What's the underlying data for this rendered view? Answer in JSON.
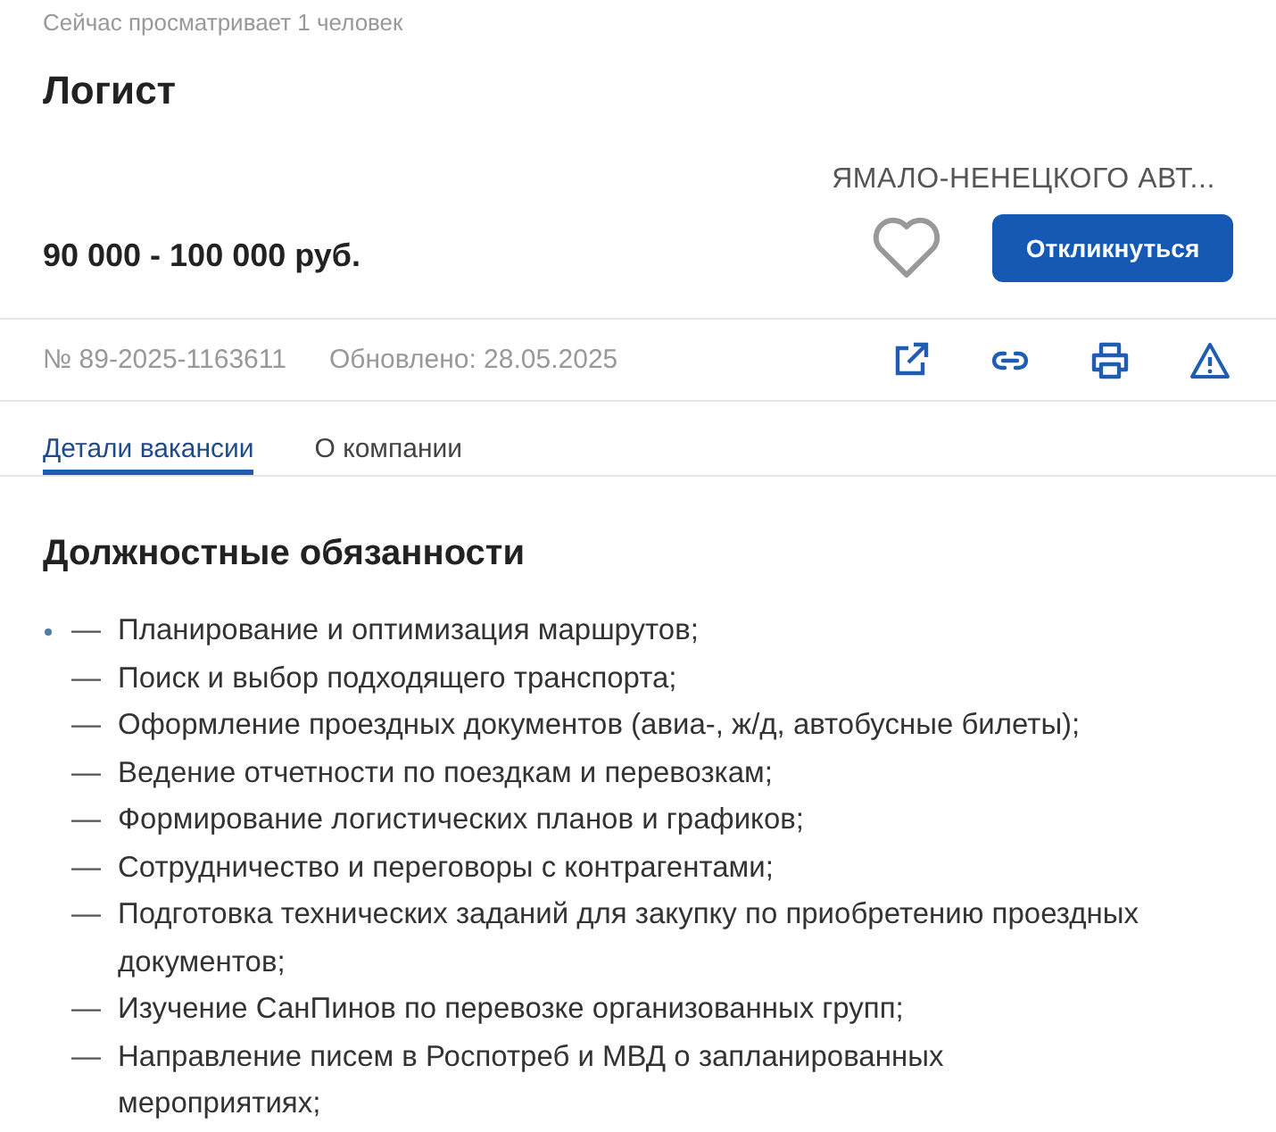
{
  "viewers": "Сейчас просматривает 1 человек",
  "title": "Логист",
  "region": "ЯМАЛО-НЕНЕЦКОГО АВТ...",
  "salary": "90 000 - 100 000 руб.",
  "favorite": false,
  "apply_button": "Откликнуться",
  "number": "№ 89-2025-1163611",
  "updated": "Обновлено: 28.05.2025",
  "actions": [
    {
      "kind": "share"
    },
    {
      "kind": "link"
    },
    {
      "kind": "print"
    },
    {
      "kind": "report"
    }
  ],
  "tabs": [
    {
      "label": "Детали вакансии",
      "selected": true
    },
    {
      "label": "О компании",
      "selected": false
    }
  ],
  "section_heading": "Должностные обязанности",
  "duties": [
    {
      "bullet": true,
      "marker": "—",
      "text": "Планирование и оптимизация маршрутов;"
    },
    {
      "bullet": false,
      "marker": "—",
      "text": "Поиск и выбор подходящего транспорта;"
    },
    {
      "bullet": false,
      "marker": "—",
      "text": "Оформление проездных документов (авиа-, ж/д, автобусные билеты);"
    },
    {
      "bullet": false,
      "marker": "—",
      "text": "Ведение отчетности по поездкам и перевозкам;"
    },
    {
      "bullet": false,
      "marker": "—",
      "text": "Формирование логистических планов и графиков;"
    },
    {
      "bullet": false,
      "marker": "—",
      "text": "Сотрудничество и переговоры с контрагентами;"
    },
    {
      "bullet": false,
      "marker": "—",
      "text": "Подготовка технических заданий для закупку по приобретению проездных документов;"
    },
    {
      "bullet": false,
      "marker": "—",
      "text": "Изучение СанПинов по перевозке организованных групп;"
    },
    {
      "bullet": false,
      "marker": "—",
      "text": "Направление писем в Роспотреб и МВД о запланированных мероприятиях;"
    }
  ]
}
